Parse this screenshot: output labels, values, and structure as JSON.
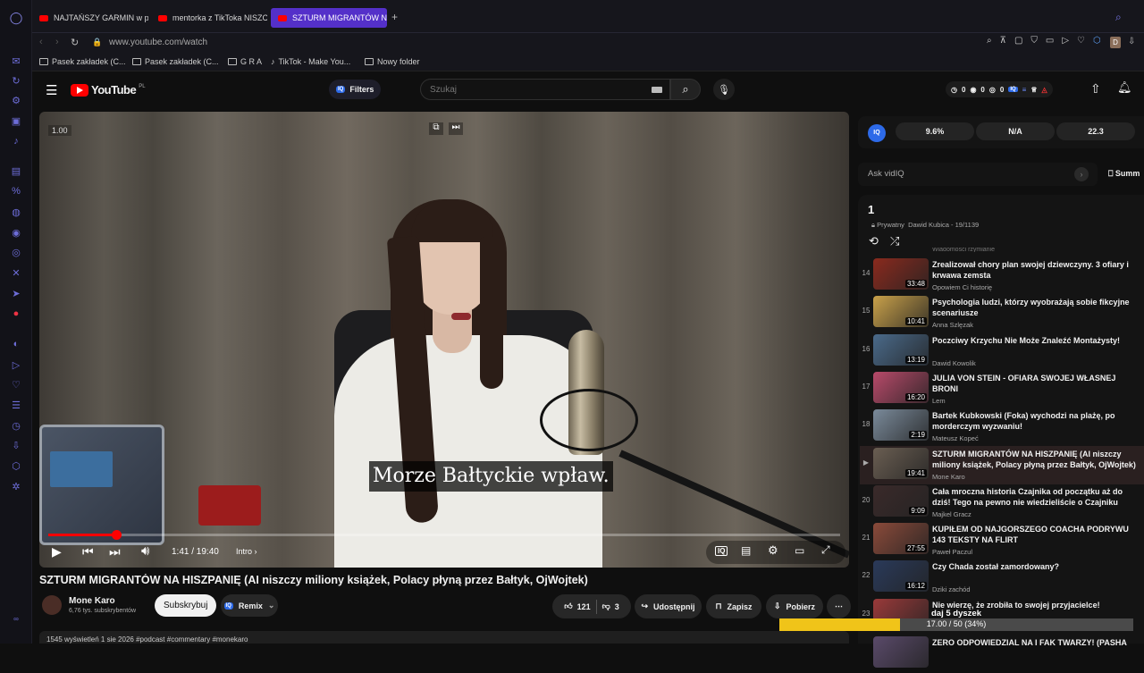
{
  "browser": {
    "tabs": [
      {
        "label": "NAJTAŃSZY GARMIN w pr"
      },
      {
        "label": "mentorka z TikToka NISZC"
      },
      {
        "label": "SZTURM MIGRANTÓW NA"
      }
    ],
    "new_tab_label": "+",
    "url": "www.youtube.com/watch",
    "profile_initial": "D",
    "bookmarks": [
      {
        "label": "Pasek zakładek (C..."
      },
      {
        "label": "Pasek zakładek (C..."
      },
      {
        "label": "G R A"
      },
      {
        "label": "TikTok - Make You..."
      },
      {
        "label": "Nowy folder"
      }
    ]
  },
  "youtube": {
    "logo_text": "YouTube",
    "logo_region": "PL",
    "filters_label": "Filters",
    "search_placeholder": "Szukaj",
    "stats": [
      "0",
      "0",
      "0"
    ]
  },
  "player": {
    "speed": "1.00",
    "subtitle": "Morze Bałtyckie wpław.",
    "time": "1:41 / 19:40",
    "chapter": "Intro ›",
    "progress_fraction": 0.086
  },
  "video": {
    "title": "SZTURM MIGRANTÓW NA HISZPANIĘ (AI niszczy miliony książek, Polacy płyną przez Bałtyk, OjWojtek)",
    "channel": "Mone Karo",
    "subscribers": "6,76 tys. subskrybentów",
    "subscribe_label": "Subskrybuj",
    "remix_label": "Remix",
    "likes": "121",
    "dislikes": "3",
    "share_label": "Udostępnij",
    "save_label": "Zapisz",
    "download_label": "Pobierz",
    "description_snippet": "1545 wyświetleń  1 sie 2026  #podcast #commentary #monekaro"
  },
  "vidiq": {
    "metrics": [
      "9.6%",
      "N/A",
      "22.3"
    ],
    "ask_placeholder": "Ask vidIQ",
    "summarize_label": "Summ"
  },
  "playlist": {
    "title": "1",
    "privacy": "Prywatny",
    "meta": "Dawid Kubica - 19/1139",
    "partial_channel": "Wiadomości rzymianie",
    "items": [
      {
        "num": "14",
        "title": "Zrealizował chory plan swojej dziewczyny. 3 ofiary i krwawa zemsta",
        "channel": "Opowiem Ci historię",
        "duration": "33:48",
        "color": "#8a2a1e"
      },
      {
        "num": "15",
        "title": "Psychologia ludzi, którzy wyobrażają sobie fikcyjne scenariusze",
        "channel": "Anna Szlęzak",
        "duration": "10:41",
        "color": "#c9a14a"
      },
      {
        "num": "16",
        "title": "Poczciwy Krzychu Nie Może Znaleźć Montażysty!",
        "channel": "Dawid Kowolik",
        "duration": "13:19",
        "color": "#4a6a8a"
      },
      {
        "num": "17",
        "title": "JULIA VON STEIN - OFIARA SWOJEJ WŁASNEJ BRONI",
        "channel": "Lem",
        "duration": "16:20",
        "color": "#b84a6a"
      },
      {
        "num": "18",
        "title": "Bartek Kubkowski (Foka) wychodzi na plażę, po morderczym wyzwaniu!",
        "channel": "Mateusz Kopeć",
        "duration": "2:19",
        "color": "#7a8a9a"
      },
      {
        "num": "▶",
        "title": "SZTURM MIGRANTÓW NA HISZPANIĘ (AI niszczy miliony książek, Polacy płyną przez Bałtyk, OjWojtek)",
        "channel": "Mone Karo",
        "duration": "19:41",
        "color": "#6a5e52"
      },
      {
        "num": "20",
        "title": "Cała mroczna historia Czajnika od początku aż do dziś! Tego na pewno nie wiedzieliście o Czajniku",
        "channel": "Majkel Gracz",
        "duration": "9:09",
        "color": "#3a2a2a"
      },
      {
        "num": "21",
        "title": "KUPIŁEM OD NAJGORSZEGO COACHA PODRYWU 143 TEKSTY NA FLIRT",
        "channel": "Paweł Paczul",
        "duration": "27:55",
        "color": "#8a4a3a"
      },
      {
        "num": "22",
        "title": "Czy Chada został zamordowany?",
        "channel": "Dziki zachód",
        "duration": "16:12",
        "color": "#2a3a5a"
      },
      {
        "num": "23",
        "title": "Nie wierzę, że zrobiła to swojej przyjacielce!",
        "channel": "",
        "duration": "",
        "color": "#9a3a3a"
      },
      {
        "num": "",
        "title": "ZERO ODPOWIEDZIAL NA I FAK TWARZY! (PASHA",
        "channel": "",
        "duration": "",
        "color": "#5a4a6a"
      }
    ]
  },
  "overlay": {
    "caption": "daj 5 dyszek",
    "progress_text": "17.00 / 50 (34%)",
    "progress_fraction": 0.34
  },
  "colors": {
    "accent": "#5430c9",
    "youtube_red": "#ff0000",
    "gold_bar": "#f0c419"
  }
}
